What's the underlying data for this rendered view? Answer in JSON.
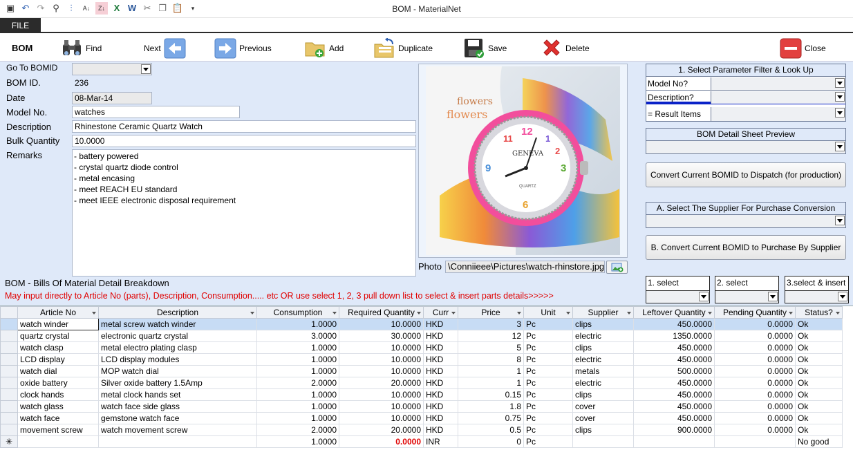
{
  "window": {
    "title": "BOM - MaterialNet"
  },
  "menu": {
    "file_tab": "FILE"
  },
  "toolbar": {
    "form_name": "BOM",
    "find": "Find",
    "next": "Next",
    "previous": "Previous",
    "add": "Add",
    "duplicate": "Duplicate",
    "save": "Save",
    "delete": "Delete",
    "close": "Close"
  },
  "form": {
    "goto_label": "Go To BOMID",
    "goto_value": "",
    "bom_id_label": "BOM ID.",
    "bom_id_value": "236",
    "date_label": "Date",
    "date_value": "08-Mar-14",
    "model_label": "Model No.",
    "model_value": "watches",
    "desc_label": "Description",
    "desc_value": "Rhinestone Ceramic Quartz Watch",
    "bulk_label": "Bulk Quantity",
    "bulk_value": "10.0000",
    "remarks_label": "Remarks",
    "remarks_lines": [
      "- battery powered",
      "- crystal quartz diode control",
      "- metal encasing",
      "- meet REACH EU standard",
      "- meet IEEE electronic disposal requirement"
    ],
    "photo_label": "Photo",
    "photo_path": "\\Conniieee\\Pictures\\watch-rhinstore.jpg",
    "watch_brand": "GENEVA",
    "watch_sub": "QUARTZ",
    "cup_text": "flowers"
  },
  "right_panel": {
    "filter_header": "1. Select Parameter Filter & Look Up",
    "filter_rows": [
      "Model No?",
      "Description?",
      "= Result Items"
    ],
    "preview_header": "BOM Detail Sheet Preview",
    "convert_dispatch": "Convert Current BOMID to Dispatch (for production)",
    "supplier_header": "A. Select The Supplier For Purchase Conversion",
    "convert_purchase": "B. Convert Current BOMID to Purchase By Supplier"
  },
  "detail": {
    "section_title": "BOM - Bills Of Material Detail Breakdown",
    "instruction": "May input directly to Article No (parts), Description, Consumption..... etc  OR use select 1, 2, 3 pull down list to select & insert parts details>>>>>",
    "select1": "1. select",
    "select2": "2. select",
    "select3": "3.select & insert"
  },
  "grid": {
    "columns": [
      "Article No",
      "Description",
      "Consumption",
      "Required Quantity",
      "Curr",
      "Price",
      "Unit",
      "Supplier",
      "Leftover Quantity",
      "Pending Quantity",
      "Status?"
    ],
    "rows": [
      [
        "watch winder",
        "metal screw watch winder",
        "1.0000",
        "10.0000",
        "HKD",
        "3",
        "Pc",
        "clips",
        "450.0000",
        "0.0000",
        "Ok"
      ],
      [
        "quartz crystal",
        "electronic quartz crystal",
        "3.0000",
        "30.0000",
        "HKD",
        "12",
        "Pc",
        "electric",
        "1350.0000",
        "0.0000",
        "Ok"
      ],
      [
        "watch clasp",
        "metal electro plating clasp",
        "1.0000",
        "10.0000",
        "HKD",
        "5",
        "Pc",
        "clips",
        "450.0000",
        "0.0000",
        "Ok"
      ],
      [
        "LCD display",
        "LCD display modules",
        "1.0000",
        "10.0000",
        "HKD",
        "8",
        "Pc",
        "electric",
        "450.0000",
        "0.0000",
        "Ok"
      ],
      [
        "watch dial",
        "MOP watch dial",
        "1.0000",
        "10.0000",
        "HKD",
        "1",
        "Pc",
        "metals",
        "500.0000",
        "0.0000",
        "Ok"
      ],
      [
        "oxide battery",
        "Silver oxide battery 1.5Amp",
        "2.0000",
        "20.0000",
        "HKD",
        "1",
        "Pc",
        "electric",
        "450.0000",
        "0.0000",
        "Ok"
      ],
      [
        "clock hands",
        "metal clock hands set",
        "1.0000",
        "10.0000",
        "HKD",
        "0.15",
        "Pc",
        "clips",
        "450.0000",
        "0.0000",
        "Ok"
      ],
      [
        "watch glass",
        "watch face side glass",
        "1.0000",
        "10.0000",
        "HKD",
        "1.8",
        "Pc",
        "cover",
        "450.0000",
        "0.0000",
        "Ok"
      ],
      [
        "watch face",
        "gemstone watch face",
        "1.0000",
        "10.0000",
        "HKD",
        "0.75",
        "Pc",
        "cover",
        "450.0000",
        "0.0000",
        "Ok"
      ],
      [
        "movement screw",
        "watch movement screw",
        "2.0000",
        "20.0000",
        "HKD",
        "0.5",
        "Pc",
        "clips",
        "900.0000",
        "0.0000",
        "Ok"
      ]
    ],
    "new_row": [
      "",
      "",
      "1.0000",
      "0.0000",
      "INR",
      "0",
      "Pc",
      "",
      "",
      "",
      "No good"
    ],
    "new_row_marker": "✳"
  }
}
